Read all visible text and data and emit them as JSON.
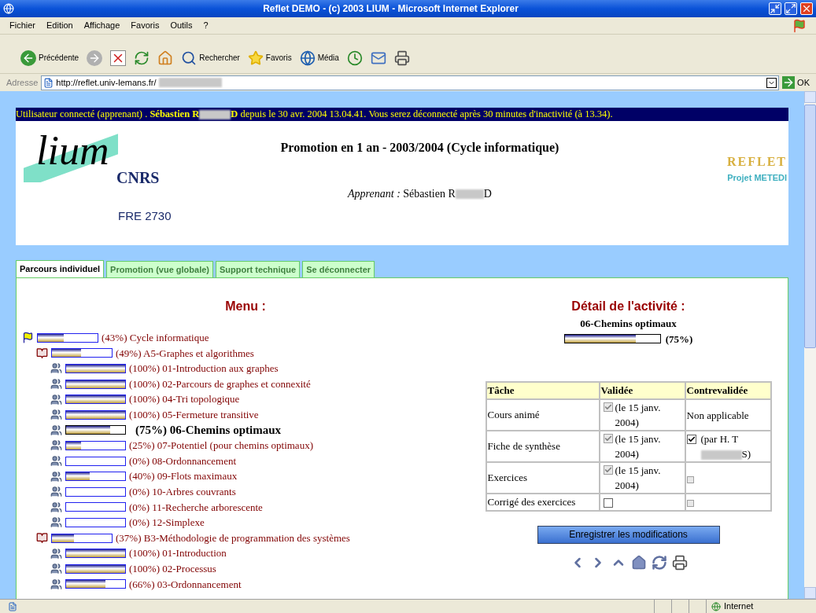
{
  "window": {
    "title": "Reflet DEMO - (c) 2003 LIUM - Microsoft Internet Explorer"
  },
  "menu_bar": [
    "Fichier",
    "Edition",
    "Affichage",
    "Favoris",
    "Outils",
    "?"
  ],
  "toolbar": [
    {
      "kind": "back",
      "label": "Précédente"
    },
    {
      "kind": "forward"
    },
    {
      "kind": "stop"
    },
    {
      "kind": "refresh"
    },
    {
      "kind": "home"
    },
    {
      "kind": "search",
      "label": "Rechercher"
    },
    {
      "kind": "favorites",
      "label": "Favoris"
    },
    {
      "kind": "media",
      "label": "Média"
    },
    {
      "kind": "history"
    },
    {
      "kind": "mail"
    },
    {
      "kind": "print"
    }
  ],
  "address": {
    "label": "Adresse",
    "value": "http://reflet.univ-lemans.fr/",
    "go": "OK"
  },
  "user_bar": {
    "prefix": "Utilisateur connecté (apprenant) .",
    "name_start": "Sébastien R",
    "name_end": "D",
    "suffix": "depuis le 30 avr. 2004 13.04.41. Vous serez déconnecté après 30 minutes d'inactivité (à 13.34)."
  },
  "header": {
    "title": "Promotion en 1 an - 2003/2004 (Cycle informatique)",
    "learner_label": "Apprenant :",
    "learner_start": "Sébastien R",
    "learner_end": "D",
    "lab_logo": "lium",
    "lab_partner": "CNRS",
    "lab_code": "FRE 2730",
    "project_logo": "REFLET",
    "project": "Projet METEDI"
  },
  "tabs": [
    {
      "label": "Parcours individuel",
      "selected": true
    },
    {
      "label": "Promotion (vue globale)",
      "selected": false
    },
    {
      "label": "Support technique",
      "selected": false
    },
    {
      "label": "Se déconnecter",
      "selected": false
    }
  ],
  "menu": {
    "title": "Menu :",
    "tree": [
      {
        "kind": "formation",
        "percent": "(43%)",
        "label": "Cycle informatique",
        "level": 0.43,
        "selected": false,
        "children": [
          {
            "kind": "module",
            "percent": "(49%)",
            "label": "A5-Graphes et algorithmes",
            "level": 0.49,
            "selected": false,
            "children": [
              {
                "kind": "activity",
                "percent": "(100%)",
                "label": "01-Introduction aux graphes",
                "level": 1,
                "selected": false
              },
              {
                "kind": "activity",
                "percent": "(100%)",
                "label": "02-Parcours de graphes et connexité",
                "level": 1,
                "selected": false
              },
              {
                "kind": "activity",
                "percent": "(100%)",
                "label": "04-Tri topologique",
                "level": 1,
                "selected": false
              },
              {
                "kind": "activity",
                "percent": "(100%)",
                "label": "05-Fermeture transitive",
                "level": 1,
                "selected": false
              },
              {
                "kind": "activity",
                "percent": "(75%)",
                "label": "06-Chemins optimaux",
                "level": 0.75,
                "selected": true
              },
              {
                "kind": "activity",
                "percent": "(25%)",
                "label": "07-Potentiel (pour chemins optimaux)",
                "level": 0.25,
                "selected": false
              },
              {
                "kind": "activity",
                "percent": "(0%)",
                "label": "08-Ordonnancement",
                "level": 0,
                "selected": false
              },
              {
                "kind": "activity",
                "percent": "(40%)",
                "label": "09-Flots maximaux",
                "level": 0.4,
                "selected": false
              },
              {
                "kind": "activity",
                "percent": "(0%)",
                "label": "10-Arbres couvrants",
                "level": 0,
                "selected": false
              },
              {
                "kind": "activity",
                "percent": "(0%)",
                "label": "11-Recherche arborescente",
                "level": 0,
                "selected": false
              },
              {
                "kind": "activity",
                "percent": "(0%)",
                "label": "12-Simplexe",
                "level": 0,
                "selected": false
              }
            ]
          },
          {
            "kind": "module",
            "percent": "(37%)",
            "label": "B3-Méthodologie de programmation des systèmes",
            "level": 0.37,
            "selected": false,
            "children": [
              {
                "kind": "activity",
                "percent": "(100%)",
                "label": "01-Introduction",
                "level": 1,
                "selected": false
              },
              {
                "kind": "activity",
                "percent": "(100%)",
                "label": "02-Processus",
                "level": 1,
                "selected": false
              },
              {
                "kind": "activity",
                "percent": "(66%)",
                "label": "03-Ordonnancement",
                "level": 0.66,
                "selected": false
              }
            ]
          }
        ]
      }
    ]
  },
  "detail": {
    "title": "Détail de l'activité :",
    "activity": "06-Chemins optimaux",
    "level": 0.75,
    "percent": "(75%)",
    "table": {
      "columns": [
        "Tâche",
        "Validée",
        "Contrevalidée"
      ],
      "rows": [
        {
          "task": "Cours animé",
          "validated": {
            "checked": true,
            "disabled": true,
            "note": "(le 15 janv. 2004)"
          },
          "counter": {
            "kind": "text",
            "text": "Non applicable"
          }
        },
        {
          "task": "Fiche de synthèse",
          "validated": {
            "checked": true,
            "disabled": true,
            "note": "(le 15 janv. 2004)"
          },
          "counter": {
            "kind": "checkbox",
            "checked": true,
            "disabled": false,
            "note_start": "(par H. T",
            "note_end": "S)"
          }
        },
        {
          "task": "Exercices",
          "validated": {
            "checked": true,
            "disabled": true,
            "note": "(le 15 janv. 2004)"
          },
          "counter": {
            "kind": "checkbox",
            "checked": false,
            "disabled": true
          }
        },
        {
          "task": "Corrigé des exercices",
          "validated": {
            "checked": false,
            "disabled": false
          },
          "counter": {
            "kind": "checkbox",
            "checked": false,
            "disabled": true
          }
        }
      ]
    },
    "save_button": "Enregistrer les modifications"
  },
  "status_bar": {
    "zone": "Internet"
  }
}
